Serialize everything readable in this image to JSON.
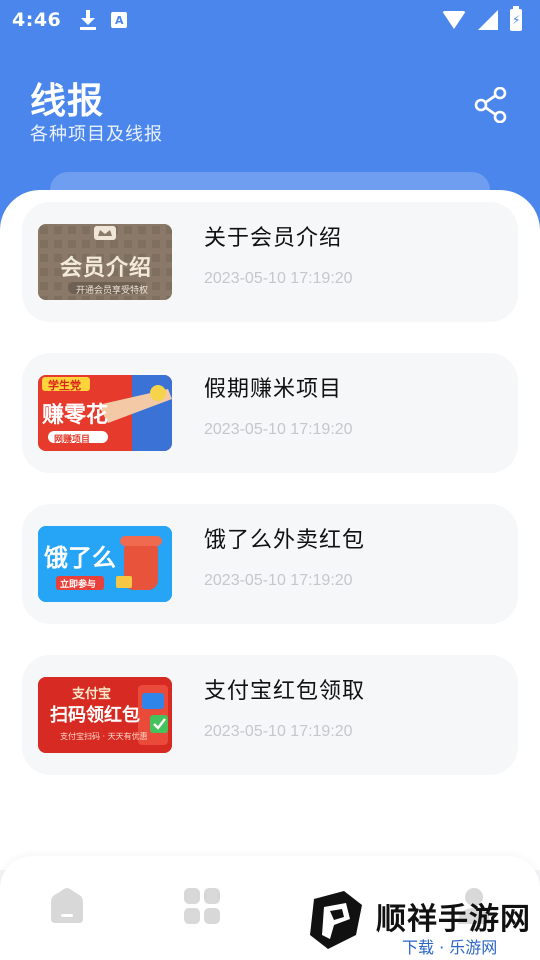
{
  "status_bar": {
    "time": "4:46",
    "a_badge": "A"
  },
  "header": {
    "title": "线报",
    "subtitle": "各种项目及线报",
    "background_color": "#4a86ec"
  },
  "articles": [
    {
      "title": "关于会员介绍",
      "time": "2023-05-10 17:19:20",
      "thumb_text": "会员介绍",
      "thumb_sub": "开通会员享受特权"
    },
    {
      "title": "假期赚米项目",
      "time": "2023-05-10 17:19:20",
      "thumb_tag": "学生党",
      "thumb_text": "赚零花",
      "thumb_sub": "网赚项目"
    },
    {
      "title": "饿了么外卖红包",
      "time": "2023-05-10 17:19:20",
      "thumb_text": "饿了么",
      "thumb_sub": "立即参与"
    },
    {
      "title": "支付宝红包领取",
      "time": "2023-05-10 17:19:20",
      "thumb_tag": "支付宝",
      "thumb_text": "扫码领红包",
      "thumb_sub": "支付宝扫码 · 天天有优惠"
    }
  ],
  "bottom_nav": {
    "items": [
      {
        "icon": "home-icon"
      },
      {
        "icon": "grid-icon"
      },
      {
        "icon": "profile-icon"
      }
    ]
  },
  "watermark": {
    "brand": "顺祥手游网",
    "sub": "下载 · 乐游网"
  }
}
